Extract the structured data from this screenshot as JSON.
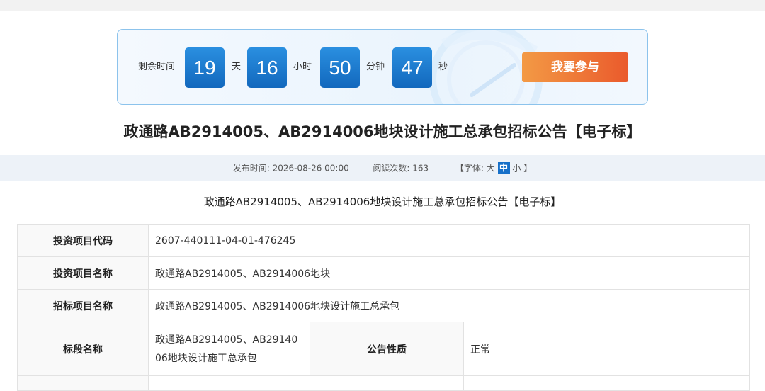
{
  "countdown": {
    "label": "剩余时间",
    "days": "19",
    "day_unit": "天",
    "hours": "16",
    "hour_unit": "小时",
    "minutes": "50",
    "minute_unit": "分钟",
    "seconds": "47",
    "second_unit": "秒",
    "join_label": "我要参与"
  },
  "page_title": "政通路AB2914005、AB2914006地块设计施工总承包招标公告【电子标】",
  "meta": {
    "publish_label": "发布时间:",
    "publish_time": "2026-08-26 00:00",
    "views_label": "阅读次数:",
    "views": "163",
    "font_prefix": "【字体:",
    "font_large": "大",
    "font_medium": "中",
    "font_small": "小",
    "font_suffix": "】"
  },
  "subtitle": "政通路AB2914005、AB2914006地块设计施工总承包招标公告【电子标】",
  "table": {
    "rows": [
      {
        "label": "投资项目代码",
        "value": "2607-440111-04-01-476245"
      },
      {
        "label": "投资项目名称",
        "value": "政通路AB2914005、AB2914006地块"
      },
      {
        "label": "招标项目名称",
        "value": "政通路AB2914005、AB2914006地块设计施工总承包"
      }
    ],
    "section": {
      "label": "标段名称",
      "value_line1": "政通路AB2914005、AB29140",
      "value_line2": "06地块设计施工总承包",
      "label2": "公告性质",
      "value2": "正常"
    }
  },
  "colors": {
    "accent_blue": "#1670c9",
    "button_orange": "#ea5a2c",
    "border_blue": "#8cc3ec"
  }
}
